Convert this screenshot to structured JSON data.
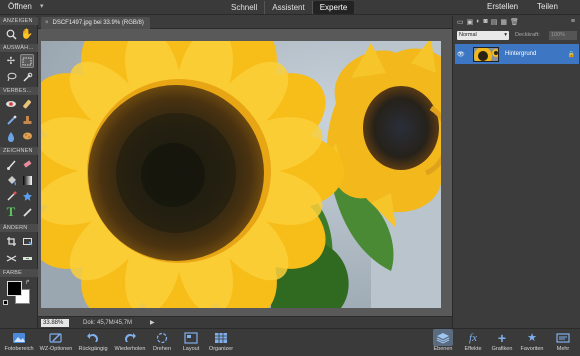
{
  "topbar": {
    "open_label": "Öffnen",
    "modes": [
      "Schnell",
      "Assistent",
      "Experte"
    ],
    "active_mode": "Experte",
    "create_label": "Erstellen",
    "share_label": "Teilen"
  },
  "document": {
    "tab_title": "DSCF1497.jpg bei 33.9% (RGB/8)",
    "zoom": "33.88%",
    "doc_size": "Dok: 45,7M/45,7M"
  },
  "tools": {
    "sections": [
      "ANZEIGEN",
      "AUSWÄH...",
      "VERBES...",
      "ZEICHNEN",
      "ÄNDERN",
      "FARBE"
    ]
  },
  "layers": {
    "blend_mode": "Normal",
    "opacity_label": "Deckkraft:",
    "opacity_value": "100%",
    "layer_name": "Hintergrund"
  },
  "bottombar": {
    "left": [
      "Fotobereich",
      "WZ-Optionen",
      "Rückgängig",
      "Wiederholen",
      "Drehen",
      "Layout",
      "Organizer"
    ],
    "right": [
      "Ebenen",
      "Effekte",
      "Grafiken",
      "Favoriten",
      "Mehr"
    ]
  },
  "colors": {
    "accent": "#3d76c2",
    "foreground": "#000000",
    "background": "#ffffff"
  }
}
